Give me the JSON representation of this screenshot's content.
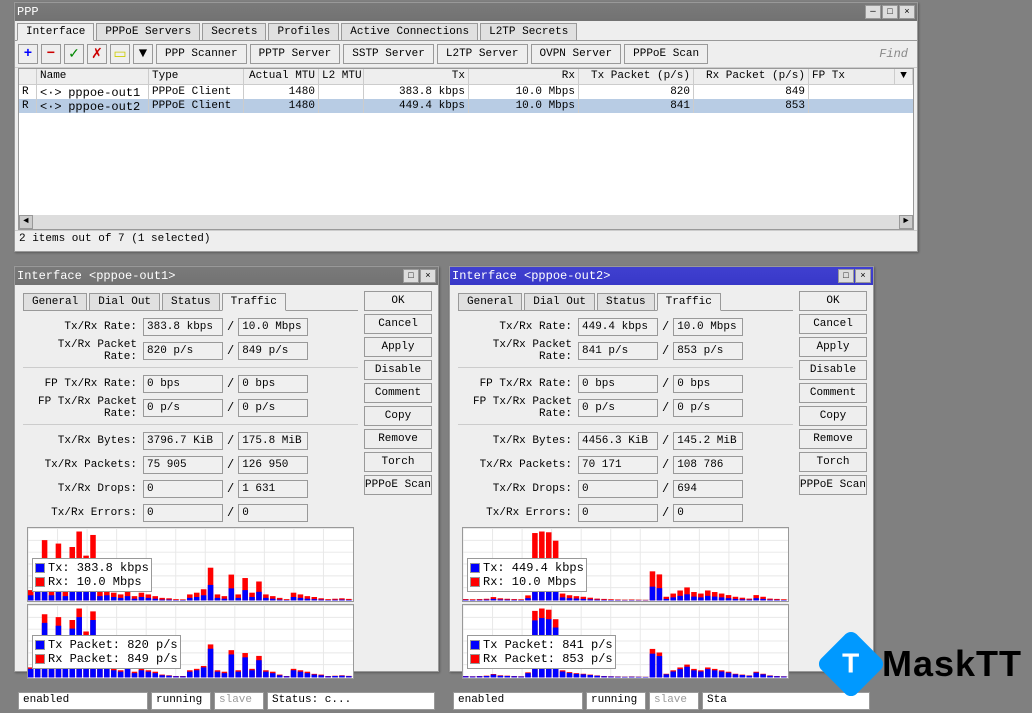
{
  "mainwin": {
    "title": "PPP",
    "tabs": [
      "Interface",
      "PPPoE Servers",
      "Secrets",
      "Profiles",
      "Active Connections",
      "L2TP Secrets"
    ],
    "toolbar": {
      "buttons": [
        "PPP Scanner",
        "PPTP Server",
        "SSTP Server",
        "L2TP Server",
        "OVPN Server",
        "PPPoE Scan"
      ],
      "find": "Find"
    },
    "cols": [
      "Name",
      "Type",
      "Actual MTU",
      "L2 MTU",
      "Tx",
      "Rx",
      "Tx Packet (p/s)",
      "Rx Packet (p/s)",
      "FP Tx"
    ],
    "rows": [
      {
        "flag": "R",
        "link": "<·>",
        "name": "pppoe-out1",
        "type": "PPPoE Client",
        "mtu": "1480",
        "l2mtu": "",
        "tx": "383.8 kbps",
        "rx": "10.0 Mbps",
        "txp": "820",
        "rxp": "849"
      },
      {
        "flag": "R",
        "link": "<·>",
        "name": "pppoe-out2",
        "type": "PPPoE Client",
        "mtu": "1480",
        "l2mtu": "",
        "tx": "449.4 kbps",
        "rx": "10.0 Mbps",
        "txp": "841",
        "rxp": "853"
      }
    ],
    "status": "2 items out of 7 (1 selected)"
  },
  "sub1": {
    "title": "Interface <pppoe-out1>",
    "tabs": [
      "General",
      "Dial Out",
      "Status",
      "Traffic"
    ],
    "buttons": [
      "OK",
      "Cancel",
      "Apply",
      "Disable",
      "Comment",
      "Copy",
      "Remove",
      "Torch",
      "PPPoE Scan"
    ],
    "fields": {
      "rate_l": "Tx/Rx Rate:",
      "rate_a": "383.8 kbps",
      "rate_b": "10.0 Mbps",
      "prate_l": "Tx/Rx Packet Rate:",
      "prate_a": "820 p/s",
      "prate_b": "849 p/s",
      "fprate_l": "FP Tx/Rx Rate:",
      "fprate_a": "0 bps",
      "fprate_b": "0 bps",
      "fpprate_l": "FP Tx/Rx Packet Rate:",
      "fpprate_a": "0 p/s",
      "fpprate_b": "0 p/s",
      "bytes_l": "Tx/Rx Bytes:",
      "bytes_a": "3796.7 KiB",
      "bytes_b": "175.8 MiB",
      "packets_l": "Tx/Rx Packets:",
      "packets_a": "75 905",
      "packets_b": "126 950",
      "drops_l": "Tx/Rx Drops:",
      "drops_a": "0",
      "drops_b": "1 631",
      "errors_l": "Tx/Rx Errors:",
      "errors_a": "0",
      "errors_b": "0"
    },
    "legend1": {
      "a": "Tx:  383.8 kbps",
      "b": "Rx:  10.0 Mbps"
    },
    "legend2": {
      "a": "Tx Packet:  820 p/s",
      "b": "Rx Packet:  849 p/s"
    },
    "bot": {
      "a": "enabled",
      "b": "running",
      "c": "slave",
      "d": "Status: c..."
    }
  },
  "sub2": {
    "title": "Interface <pppoe-out2>",
    "tabs": [
      "General",
      "Dial Out",
      "Status",
      "Traffic"
    ],
    "buttons": [
      "OK",
      "Cancel",
      "Apply",
      "Disable",
      "Comment",
      "Copy",
      "Remove",
      "Torch",
      "PPPoE Scan"
    ],
    "fields": {
      "rate_l": "Tx/Rx Rate:",
      "rate_a": "449.4 kbps",
      "rate_b": "10.0 Mbps",
      "prate_l": "Tx/Rx Packet Rate:",
      "prate_a": "841 p/s",
      "prate_b": "853 p/s",
      "fprate_l": "FP Tx/Rx Rate:",
      "fprate_a": "0 bps",
      "fprate_b": "0 bps",
      "fpprate_l": "FP Tx/Rx Packet Rate:",
      "fpprate_a": "0 p/s",
      "fpprate_b": "0 p/s",
      "bytes_l": "Tx/Rx Bytes:",
      "bytes_a": "4456.3 KiB",
      "bytes_b": "145.2 MiB",
      "packets_l": "Tx/Rx Packets:",
      "packets_a": "70 171",
      "packets_b": "108 786",
      "drops_l": "Tx/Rx Drops:",
      "drops_a": "0",
      "drops_b": "694",
      "errors_l": "Tx/Rx Errors:",
      "errors_a": "0",
      "errors_b": "0"
    },
    "legend1": {
      "a": "Tx:  449.4 kbps",
      "b": "Rx:  10.0 Mbps"
    },
    "legend2": {
      "a": "Tx Packet:  841 p/s",
      "b": "Rx Packet:  853 p/s"
    },
    "bot": {
      "a": "enabled",
      "b": "running",
      "c": "slave",
      "d": "Sta"
    }
  },
  "logo": {
    "badge": "T",
    "text": "MaskTT"
  },
  "chart_data": [
    {
      "type": "bar",
      "title": "pppoe-out1 Tx/Rx Rate",
      "series": [
        {
          "name": "Tx",
          "color": "#0000ff",
          "values": [
            60,
            120,
            340,
            60,
            320,
            50,
            300,
            380,
            240,
            360,
            50,
            60,
            40,
            30,
            50,
            20,
            40,
            30,
            20,
            10,
            10,
            5,
            5,
            30,
            40,
            60,
            180,
            30,
            20,
            140,
            30,
            120,
            40,
            100,
            30,
            20,
            10,
            5,
            40,
            30,
            20,
            15,
            10,
            5,
            8,
            10,
            6
          ]
        },
        {
          "name": "Rx",
          "color": "#ff0000",
          "values": [
            120,
            260,
            700,
            140,
            660,
            110,
            620,
            800,
            520,
            760,
            110,
            130,
            90,
            70,
            110,
            50,
            90,
            70,
            50,
            30,
            25,
            15,
            12,
            70,
            90,
            130,
            380,
            70,
            50,
            300,
            70,
            260,
            90,
            220,
            70,
            50,
            30,
            15,
            90,
            70,
            50,
            40,
            25,
            15,
            20,
            25,
            18
          ]
        }
      ]
    },
    {
      "type": "bar",
      "title": "pppoe-out1 Tx/Rx Packets",
      "series": [
        {
          "name": "Tx Packet",
          "color": "#0000ff",
          "values": [
            60,
            140,
            380,
            70,
            360,
            60,
            340,
            420,
            280,
            400,
            60,
            70,
            50,
            40,
            60,
            30,
            50,
            40,
            30,
            15,
            12,
            8,
            8,
            40,
            50,
            70,
            200,
            40,
            30,
            160,
            40,
            140,
            50,
            120,
            40,
            30,
            15,
            8,
            50,
            40,
            30,
            20,
            15,
            8,
            10,
            12,
            9
          ]
        },
        {
          "name": "Rx Packet",
          "color": "#ff0000",
          "values": [
            70,
            160,
            440,
            80,
            420,
            70,
            400,
            480,
            320,
            460,
            70,
            80,
            60,
            50,
            70,
            40,
            60,
            50,
            40,
            20,
            15,
            10,
            10,
            50,
            60,
            80,
            230,
            50,
            40,
            190,
            50,
            170,
            60,
            150,
            50,
            40,
            20,
            10,
            60,
            50,
            40,
            25,
            20,
            10,
            12,
            15,
            11
          ]
        }
      ]
    },
    {
      "type": "bar",
      "title": "pppoe-out2 Tx/Rx Rate",
      "series": [
        {
          "name": "Tx",
          "color": "#0000ff",
          "values": [
            8,
            6,
            8,
            10,
            20,
            12,
            10,
            8,
            6,
            30,
            420,
            440,
            430,
            360,
            40,
            30,
            25,
            20,
            15,
            10,
            8,
            6,
            5,
            4,
            5,
            4,
            3,
            180,
            160,
            20,
            40,
            60,
            80,
            50,
            40,
            60,
            50,
            40,
            30,
            20,
            15,
            10,
            30,
            20,
            10,
            8,
            6
          ]
        },
        {
          "name": "Rx",
          "color": "#ff0000",
          "values": [
            18,
            15,
            18,
            22,
            44,
            28,
            22,
            18,
            15,
            66,
            880,
            900,
            890,
            780,
            90,
            68,
            56,
            48,
            36,
            24,
            20,
            16,
            12,
            10,
            12,
            10,
            8,
            380,
            340,
            48,
            90,
            130,
            170,
            110,
            90,
            130,
            110,
            90,
            70,
            48,
            36,
            24,
            70,
            48,
            24,
            20,
            15
          ]
        }
      ]
    },
    {
      "type": "bar",
      "title": "pppoe-out2 Tx/Rx Packets",
      "series": [
        {
          "name": "Tx Packet",
          "color": "#0000ff",
          "values": [
            10,
            8,
            10,
            12,
            24,
            14,
            12,
            10,
            8,
            36,
            480,
            500,
            490,
            420,
            50,
            38,
            30,
            26,
            20,
            14,
            10,
            8,
            6,
            5,
            6,
            5,
            4,
            200,
            180,
            26,
            50,
            70,
            90,
            60,
            50,
            70,
            60,
            50,
            40,
            26,
            20,
            14,
            40,
            26,
            14,
            10,
            8
          ]
        },
        {
          "name": "Rx Packet",
          "color": "#ff0000",
          "values": [
            12,
            10,
            12,
            15,
            29,
            18,
            15,
            12,
            10,
            43,
            560,
            580,
            570,
            490,
            60,
            45,
            36,
            31,
            24,
            17,
            12,
            10,
            8,
            6,
            8,
            6,
            5,
            240,
            210,
            31,
            60,
            84,
            108,
            72,
            60,
            84,
            72,
            60,
            48,
            31,
            24,
            17,
            48,
            31,
            17,
            12,
            10
          ]
        }
      ]
    }
  ]
}
